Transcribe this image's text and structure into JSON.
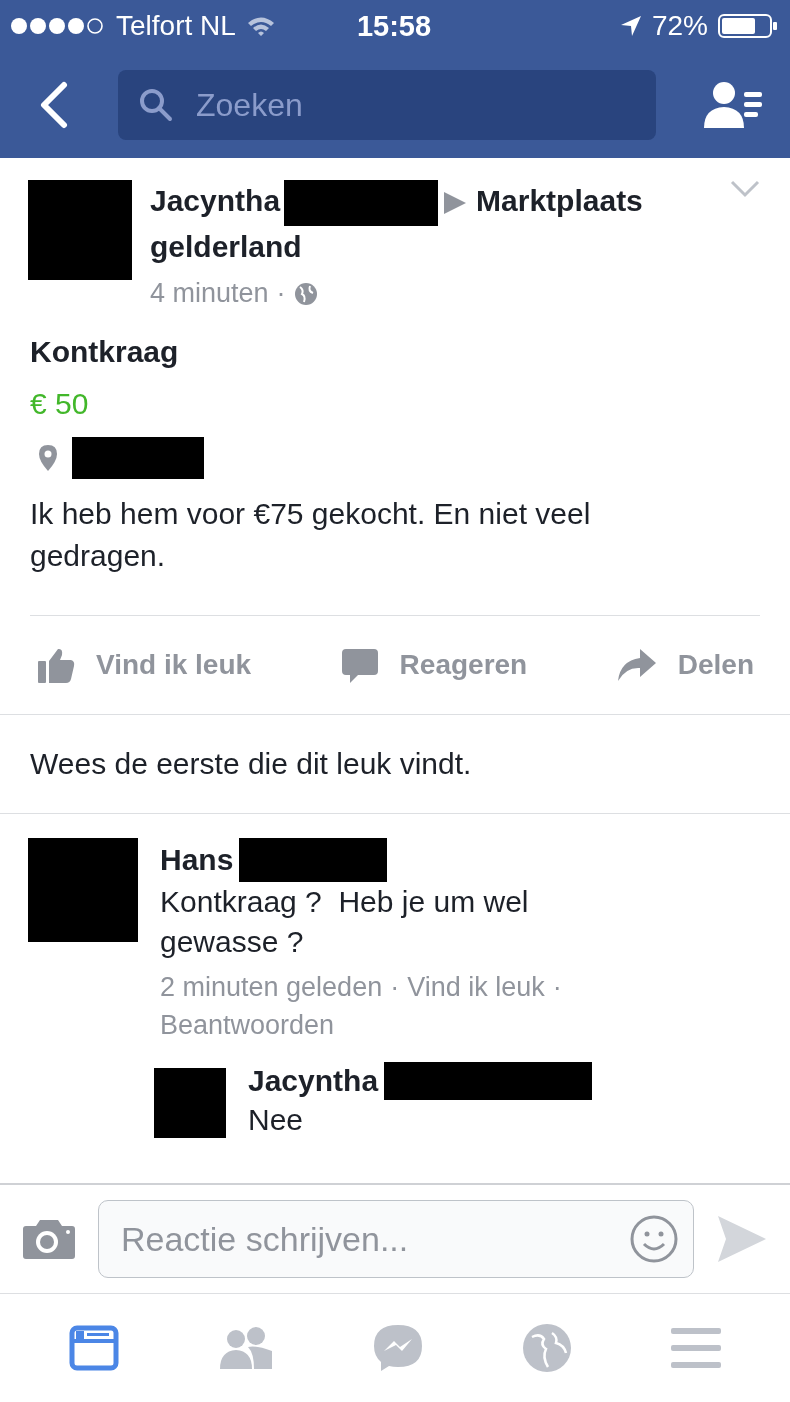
{
  "status_bar": {
    "carrier": "Telfort NL",
    "time": "15:58",
    "battery": "72%"
  },
  "nav": {
    "search": {
      "placeholder": "Zoeken"
    }
  },
  "post": {
    "author": "Jacyntha",
    "group_lines": [
      "Marktplaats",
      "gelderland"
    ],
    "time": "4 minuten",
    "separator": "·",
    "listing": {
      "title": "Kontkraag",
      "price": "€ 50"
    },
    "text": "Ik heb hem voor €75 gekocht. En niet veel gedragen.",
    "actions": [
      {
        "kind": "like",
        "label": "Vind ik leuk"
      },
      {
        "kind": "comment",
        "label": "Reageren"
      },
      {
        "kind": "share",
        "label": "Delen"
      }
    ],
    "likes_summary": "Wees de eerste die dit leuk vindt."
  },
  "comments": [
    {
      "author": "Hans",
      "text": "Kontkraag ?  Heb je um wel gewasse ?",
      "separator": "·",
      "meta": [
        "2 minuten geleden",
        "Vind ik leuk",
        "Beantwoorden"
      ],
      "replies": [
        {
          "author": "Jacyntha",
          "text": "Nee"
        }
      ]
    }
  ],
  "composer": {
    "placeholder": "Reactie schrijven..."
  },
  "tab_bar": [
    {
      "kind": "feed",
      "selected": true
    },
    {
      "kind": "friends",
      "selected": false
    },
    {
      "kind": "messenger",
      "selected": false
    },
    {
      "kind": "globe",
      "selected": false
    },
    {
      "kind": "menu",
      "selected": false
    }
  ]
}
